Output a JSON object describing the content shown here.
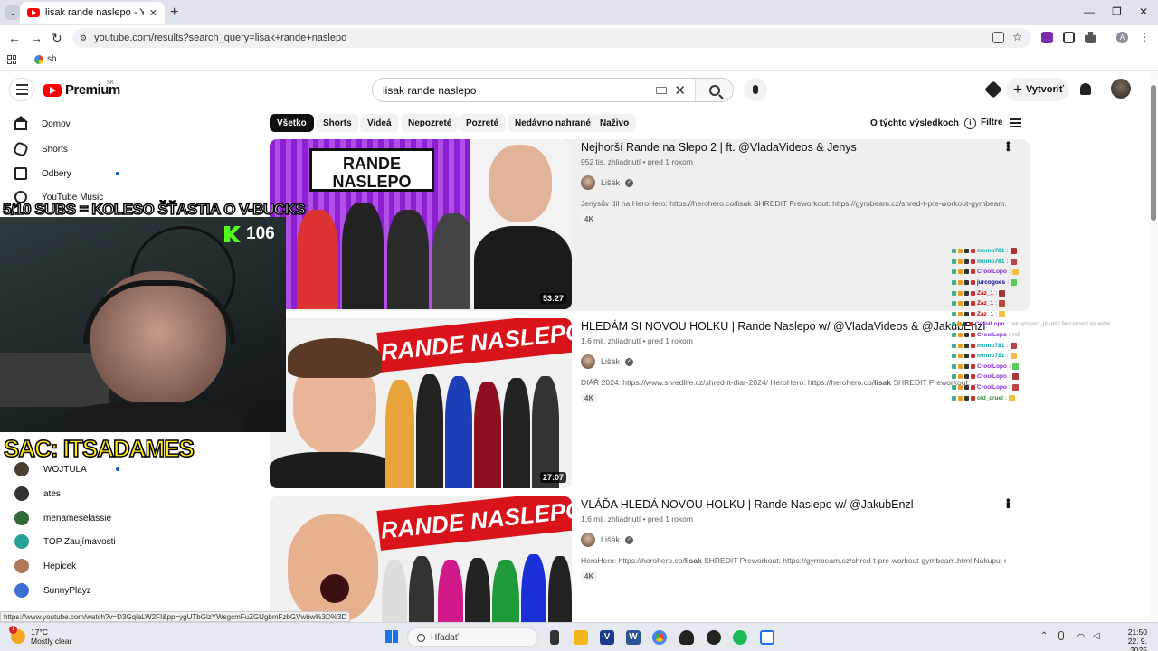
{
  "browser": {
    "tab_title": "lisak rande naslepo - YouTube",
    "tab_close": "✕",
    "new_tab": "+",
    "url": "youtube.com/results?search_query=lisak+rande+naslepo",
    "bookmark": "sh",
    "minimize": "—",
    "restore": "❐",
    "close": "✕",
    "profile_initial": "A"
  },
  "youtube": {
    "logo_word": "Premium",
    "region": "SK",
    "search_query": "lisak rande naslepo",
    "clear_glyph": "✕",
    "create_label": "Vytvoriť",
    "create_plus": "+"
  },
  "sidebar": {
    "items": [
      {
        "label": "Domov",
        "icon": "home-icon"
      },
      {
        "label": "Shorts",
        "icon": "shorts-icon"
      },
      {
        "label": "Odbery",
        "icon": "subscriptions-icon"
      },
      {
        "label": "YouTube Music",
        "icon": "music-icon"
      }
    ],
    "channels": [
      {
        "label": "WOJTULA",
        "color": "#4a4030"
      },
      {
        "label": "ates",
        "color": "#2e3338"
      },
      {
        "label": "menameselassie",
        "color": "#2f6a36"
      },
      {
        "label": "TOP Zaujímavosti",
        "color": "#2aa198"
      },
      {
        "label": "Hepicek",
        "color": "#b07a5a"
      },
      {
        "label": "SunnyPlayz",
        "color": "#3c6fd1"
      }
    ]
  },
  "filters": {
    "chips": [
      "Všetko",
      "Shorts",
      "Videá",
      "Nepozreté",
      "Pozreté",
      "Nedávno nahrané",
      "Naživo"
    ],
    "about": "O týchto výsledkoch",
    "info_glyph": "i",
    "filter_label": "Filtre"
  },
  "results": [
    {
      "title": "Nejhorší Rande na Slepo 2 | ft. @VladaVideos & Jenys",
      "meta": "952 tis. zhliadnutí • pred 1 rokom",
      "channel": "Lišák",
      "desc": "Jenysův díl na HeroHero: https://herohero.co/lisak SHREDIT Preworkout: https://gymbeam.cz/shred-t-pre-workout-gymbeam.html ...",
      "badge": "4K",
      "duration": "53:27",
      "thumb_text": "RANDE NASLEPO"
    },
    {
      "title": "HLEDÁM SI NOVOU HOLKU | Rande Naslepo w/ @VladaVideos & @JakubEnzl",
      "meta": "1,6 mil. zhliadnutí • pred 1 rokom",
      "channel": "Lišák",
      "desc_pre": "DIÁŘ 2024: https://www.shredlife.cz/shred-it-diar-2024/ HeroHero: https://herohero.co/",
      "desc_bold": "lisak",
      "desc_post": " SHREDIT Preworkout: ...",
      "badge": "4K",
      "duration": "27:07",
      "thumb_text": "RANDE NASLEPO"
    },
    {
      "title": "VLÁĎA HLEDÁ NOVOU HOLKU | Rande Naslepo w/ @JakubEnzl",
      "meta": "1,6 mil. zhliadnutí • pred 1 rokom",
      "channel": "Lišák",
      "desc_pre": "HeroHero: https://herohero.co/",
      "desc_bold": "lisak",
      "desc_post": " SHREDIT Preworkout: https://gymbeam.cz/shred-t-pre-workout-gymbeam.html Nakupuj na ...",
      "badge": "4K",
      "thumb_text": "RANDE NASLEPO"
    }
  ],
  "overlay": {
    "goal": "5/10 SUBS = KOLESO ŠŤASTIA O V-BUCKS",
    "kick_count": "106",
    "sac": "SAC: ITSADAMES"
  },
  "chat": [
    {
      "name": "momo781",
      "color": "#0aa",
      "msg": ""
    },
    {
      "name": "momo781",
      "color": "#0aa",
      "msg": ""
    },
    {
      "name": "CroolLopo",
      "color": "#8a2be2",
      "msg": ""
    },
    {
      "name": "jurcogoes",
      "color": "#00a",
      "msg": ""
    },
    {
      "name": "Zaz_1",
      "color": "#c00",
      "msg": ""
    },
    {
      "name": "Zaz_1",
      "color": "#c00",
      "msg": ""
    },
    {
      "name": "Zaz_1",
      "color": "#c00",
      "msg": ""
    },
    {
      "name": "CroolLopo",
      "color": "#8a2be2",
      "msg": "tak sposoci, já umil ile carosoi sa exite"
    },
    {
      "name": "CroolLopo",
      "color": "#8a2be2",
      "msg": "roll"
    },
    {
      "name": "momo781",
      "color": "#0aa",
      "msg": ""
    },
    {
      "name": "momo781",
      "color": "#0aa",
      "msg": ""
    },
    {
      "name": "CroolLopo",
      "color": "#8a2be2",
      "msg": ""
    },
    {
      "name": "CroolLopo",
      "color": "#8a2be2",
      "msg": ""
    },
    {
      "name": "CroolLopo",
      "color": "#8a2be2",
      "msg": ""
    },
    {
      "name": "old_cruel",
      "color": "#2a8a2a",
      "msg": ""
    }
  ],
  "status_url": "https://www.youtube.com/watch?v=D3GqiaLW2FI&pp=ygUTbGlzYWsgcmFuZGUgbmFzbGVwbw%3D%3D",
  "taskbar": {
    "temp": "17°C",
    "weather": "Mostly clear",
    "weather_badge": "1",
    "search": "Hľadať",
    "time": "21:50",
    "date": "22. 9. 2025",
    "tray_up": "⌃"
  }
}
